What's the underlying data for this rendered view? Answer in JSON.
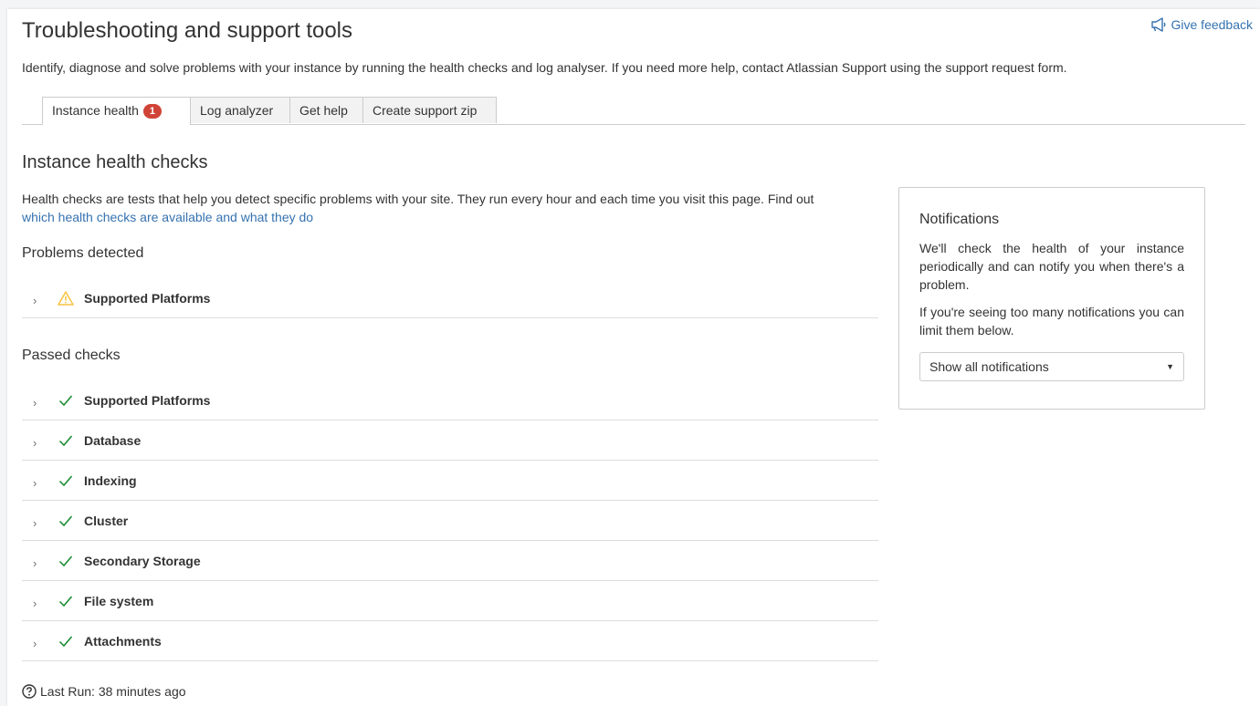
{
  "header": {
    "title": "Troubleshooting and support tools",
    "feedback_label": "Give feedback",
    "intro": "Identify, diagnose and solve problems with your instance by running the health checks and log analyser. If you need more help, contact Atlassian Support using the support request form."
  },
  "tabs": [
    {
      "label": "Instance health",
      "badge": "1"
    },
    {
      "label": "Log analyzer"
    },
    {
      "label": "Get help"
    },
    {
      "label": "Create support zip"
    }
  ],
  "main": {
    "section_title": "Instance health checks",
    "description": "Health checks are tests that help you detect specific problems with your site. They run every hour and each time you visit this page. Find out",
    "description_link": "which health checks are available and what they do",
    "problems_title": "Problems detected",
    "problems": [
      {
        "name": "Supported Platforms",
        "status": "warning-icon"
      }
    ],
    "passed_title": "Passed checks",
    "passed": [
      {
        "name": "Supported Platforms",
        "status": "check-icon"
      },
      {
        "name": "Database",
        "status": "check-icon"
      },
      {
        "name": "Indexing",
        "status": "check-icon"
      },
      {
        "name": "Cluster",
        "status": "check-icon"
      },
      {
        "name": "Secondary Storage",
        "status": "check-icon"
      },
      {
        "name": "File system",
        "status": "check-icon"
      },
      {
        "name": "Attachments",
        "status": "check-icon"
      }
    ],
    "last_run": "Last Run: 38 minutes ago"
  },
  "notifications": {
    "title": "Notifications",
    "text1": "We'll check the health of your instance periodically and can notify you when there's a problem.",
    "text2": "If you're seeing too many notifications you can limit them below.",
    "select_value": "Show all notifications"
  },
  "colors": {
    "link": "#3572b0",
    "badge": "#d04437",
    "warning": "#f6c342",
    "success": "#14892c"
  }
}
